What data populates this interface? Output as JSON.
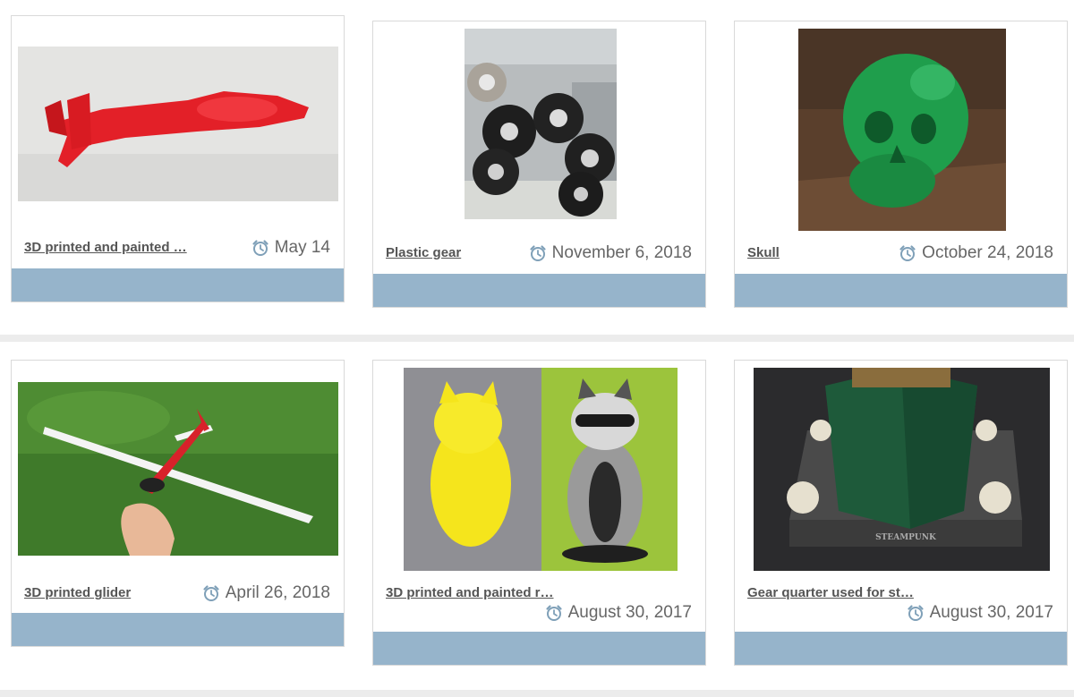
{
  "colors": {
    "footer_bar": "#96b4cb",
    "title_text": "#555555",
    "date_text": "#666666",
    "clock_icon": "#7fa0b8",
    "divider": "#ececec"
  },
  "posts": [
    {
      "title": "3D printed and painted …",
      "date": "May 14",
      "image_icon": "red-helicopter-image"
    },
    {
      "title": "Plastic gear",
      "date": "November 6, 2018",
      "image_icon": "gears-image"
    },
    {
      "title": "Skull",
      "date": "October 24, 2018",
      "image_icon": "green-skull-image"
    },
    {
      "title": "3D printed glider",
      "date": "April 26, 2018",
      "image_icon": "glider-image"
    },
    {
      "title": "3D printed and painted r…",
      "date": "August 30, 2017",
      "image_icon": "raccoon-image"
    },
    {
      "title": "Gear quarter used for st…",
      "date": "August 30, 2017",
      "image_icon": "steampunk-box-image"
    }
  ],
  "image_text": {
    "steampunk_plate": "STEAMPUNK"
  }
}
